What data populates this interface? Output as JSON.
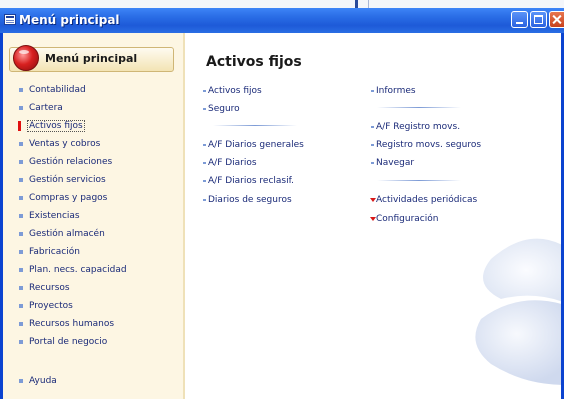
{
  "window": {
    "title": "Menú principal"
  },
  "nav": {
    "header": "Menú principal",
    "items": [
      {
        "label": "Contabilidad",
        "active": false
      },
      {
        "label": "Cartera",
        "active": false
      },
      {
        "label": "Activos fijos",
        "active": true
      },
      {
        "label": "Ventas y cobros",
        "active": false
      },
      {
        "label": "Gestión relaciones",
        "active": false
      },
      {
        "label": "Gestión servicios",
        "active": false
      },
      {
        "label": "Compras y pagos",
        "active": false
      },
      {
        "label": "Existencias",
        "active": false
      },
      {
        "label": "Gestión almacén",
        "active": false
      },
      {
        "label": "Fabricación",
        "active": false
      },
      {
        "label": "Plan. necs. capacidad",
        "active": false
      },
      {
        "label": "Recursos",
        "active": false
      },
      {
        "label": "Proyectos",
        "active": false
      },
      {
        "label": "Recursos humanos",
        "active": false
      },
      {
        "label": "Portal de negocio",
        "active": false
      }
    ],
    "help": "Ayuda"
  },
  "main": {
    "title": "Activos fijos",
    "col1": [
      "Activos fijos",
      "Seguro",
      "A/F Diarios generales",
      "A/F Diarios",
      "A/F Diarios reclasif.",
      "Diarios de seguros"
    ],
    "col2": [
      "Informes",
      "A/F Registro movs.",
      "Registro movs. seguros",
      "Navegar",
      "Actividades periódicas",
      "Configuración"
    ]
  },
  "colors": {
    "titlebar": "#2a6de6",
    "nav_background": "#fdf6e3",
    "link_text": "#1a2a78",
    "active_marker": "#e01010",
    "submenu_arrow": "#d81818"
  },
  "icons": {
    "window": "menu-window-icon",
    "nav_logo": "red-sphere-logo-icon",
    "bullet": "square-bullet-icon",
    "submenu": "triangle-down-icon"
  }
}
